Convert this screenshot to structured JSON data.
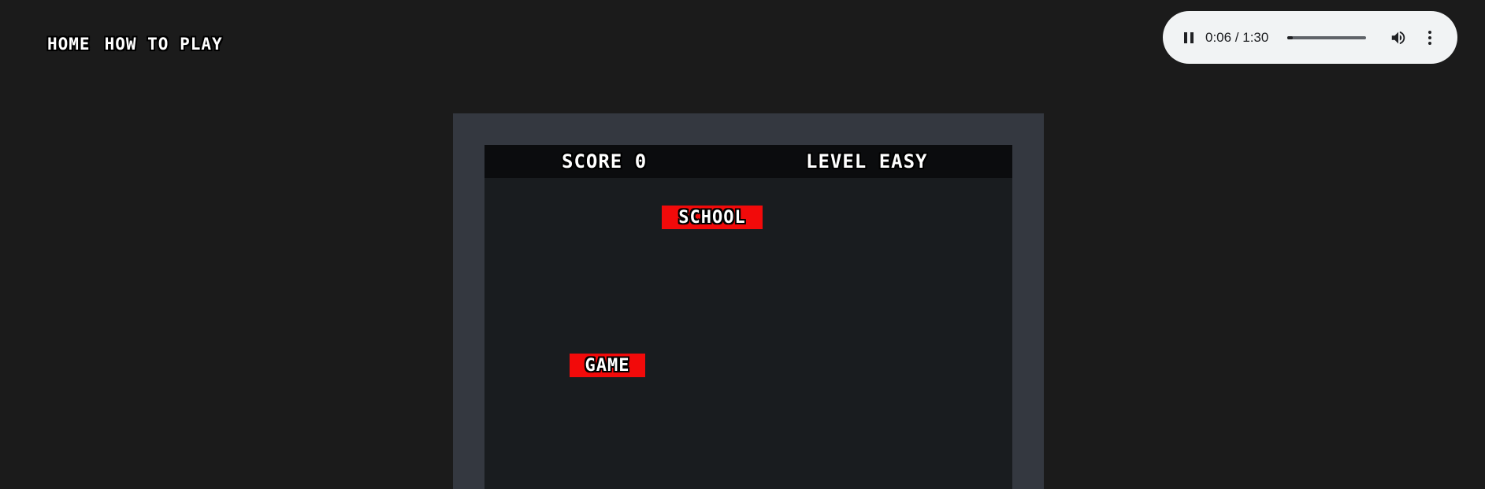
{
  "nav": {
    "home": "HOME",
    "how_to_play": "HOW TO PLAY"
  },
  "audio": {
    "current_time": "0:06",
    "duration": "1:30",
    "time_display": "0:06 / 1:30",
    "progress_fraction": 0.067,
    "icons": [
      "pause-icon",
      "volume-icon",
      "more-options-icon"
    ]
  },
  "hud": {
    "score": "SCORE 0",
    "level": "LEVEL EASY"
  },
  "words": [
    {
      "text": "SCHOOL",
      "color": "#f20a0a"
    },
    {
      "text": "GAME",
      "color": "#f20a0a"
    }
  ],
  "colors": {
    "page_bg": "#1b1b1b",
    "frame": "#343840",
    "board": "#191c1f",
    "hud_bg": "#0b0c0e",
    "word_bg": "#f20a0a"
  }
}
